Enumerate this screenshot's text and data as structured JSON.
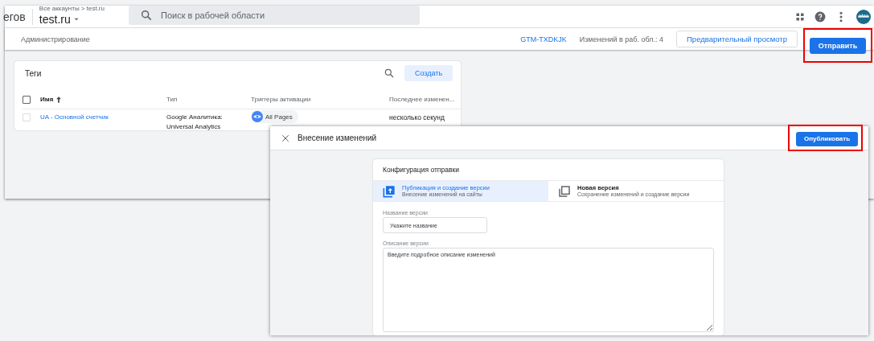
{
  "header": {
    "product_tail": "егов",
    "breadcrumb": "Все аккаунты > test.ru",
    "container": "test.ru",
    "search": {
      "placeholder": "Поиск в рабочей области"
    }
  },
  "subbar": {
    "tab": "Администрирование",
    "container_id": "GTM-TXDKJK",
    "changes": "Изменений в раб. обл.: 4",
    "preview_button": "Предварительный просмотр",
    "submit_button": {
      "label": "Отправить",
      "highlighted": true
    }
  },
  "tags_card": {
    "title": "Теги",
    "create_button": "Создать",
    "select_all_checked": false,
    "columns": [
      {
        "label": "Имя",
        "sorted": true
      },
      {
        "label": "Тип",
        "sorted": false
      },
      {
        "label": "Триггеры активации",
        "sorted": false
      },
      {
        "label": "Последнее изменен...",
        "sorted": false
      }
    ],
    "rows": [
      {
        "checked": false,
        "name": "UA - Основной счетчик",
        "type": "Google Аналитика: Universal Analytics",
        "trigger": "All Pages",
        "modified": "несколько секунд"
      }
    ]
  },
  "dialog": {
    "title": "Внесение изменений",
    "publish_button": {
      "label": "Опубликовать",
      "highlighted": true
    },
    "config": {
      "title": "Конфигурация отправки",
      "options": [
        {
          "title": "Публикация и создание версии",
          "subtitle": "Внесение изменений на сайты",
          "selected": true
        },
        {
          "title": "Новая версия",
          "subtitle": "Сохранение изменений и создание версии",
          "selected": false
        }
      ],
      "version_name": {
        "label": "Название версии",
        "placeholder": "Укажите название"
      },
      "version_description": {
        "label": "Описание версии",
        "placeholder": "Введите подробное описание изменений"
      }
    }
  }
}
